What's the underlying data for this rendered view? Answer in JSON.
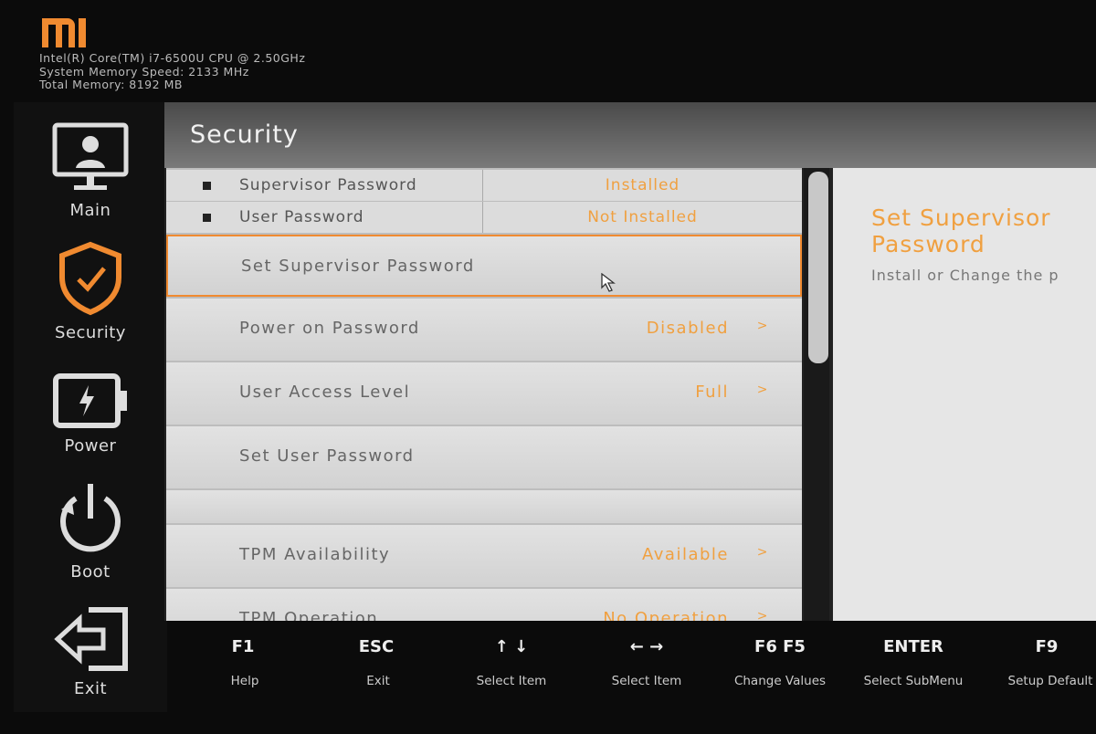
{
  "brand": {
    "logo": "MI",
    "color": "#f08a30"
  },
  "system_info": {
    "cpu": "Intel(R) Core(TM) i7-6500U CPU @ 2.50GHz",
    "memory_speed": "System Memory Speed: 2133 MHz",
    "total_memory": "Total Memory: 8192 MB"
  },
  "sidebar": {
    "items": [
      {
        "label": "Main",
        "icon": "monitor-user-icon"
      },
      {
        "label": "Security",
        "icon": "shield-check-icon",
        "active": true
      },
      {
        "label": "Power",
        "icon": "battery-icon"
      },
      {
        "label": "Boot",
        "icon": "power-icon"
      },
      {
        "label": "Exit",
        "icon": "exit-arrow-icon"
      }
    ]
  },
  "page": {
    "title": "Security"
  },
  "info_rows": [
    {
      "label": "Supervisor Password",
      "value": "Installed"
    },
    {
      "label": "User Password",
      "value": "Not Installed"
    }
  ],
  "rows": [
    {
      "label": "Set Supervisor Password",
      "value": "",
      "selected": true
    },
    {
      "label": "Power on Password",
      "value": "Disabled",
      "chevron": ">"
    },
    {
      "label": "User Access Level",
      "value": "Full",
      "chevron": ">"
    },
    {
      "label": "Set User Password",
      "value": ""
    },
    {
      "label": "TPM Availability",
      "value": "Available",
      "chevron": ">"
    },
    {
      "label": "TPM Operation",
      "value": "No Operation",
      "chevron": ">"
    }
  ],
  "help": {
    "title": "Set Supervisor Password",
    "description": "Install or Change the p"
  },
  "footer": {
    "keys": [
      {
        "key": "F1",
        "label": "Help"
      },
      {
        "key": "ESC",
        "label": "Exit"
      },
      {
        "key": "↑   ↓",
        "label": "Select Item"
      },
      {
        "key": "←   →",
        "label": "Select Item"
      },
      {
        "key": "F6   F5",
        "label": "Change Values"
      },
      {
        "key": "ENTER",
        "label": "Select  SubMenu"
      },
      {
        "key": "F9",
        "label": "Setup Default"
      }
    ]
  },
  "colors": {
    "accent": "#f0a040",
    "selection_border": "#f08a30"
  }
}
